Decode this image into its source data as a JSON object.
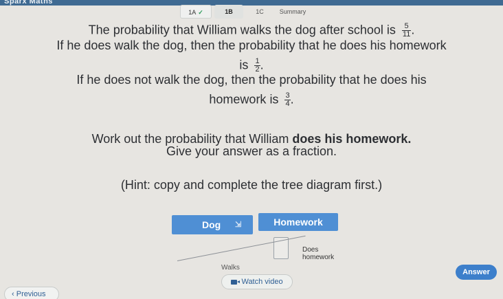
{
  "app": {
    "logo": "Sparx Maths"
  },
  "tabs": [
    {
      "label": "1A",
      "completed": true
    },
    {
      "label": "1B"
    },
    {
      "label": "1C"
    },
    {
      "label": "Summary"
    }
  ],
  "question": {
    "line1_pre": "The probability that William walks the dog after school is",
    "p_walk": {
      "num": "5",
      "den": "11"
    },
    "line2": "If he does walk the dog, then the probability that he does his homework",
    "line3_pre": "is",
    "p_hw_given_walk": {
      "num": "1",
      "den": "2"
    },
    "line4": "If he does not walk the dog, then the probability that he does his",
    "line5_pre": "homework is",
    "p_hw_given_not": {
      "num": "3",
      "den": "4"
    },
    "line6_pre": "Work out the probability that William",
    "line6_bold": "does his homework.",
    "line7": "Give your answer as a fraction.",
    "hint": "(Hint: copy and complete the tree diagram first.)"
  },
  "diagram": {
    "dog_label": "Dog",
    "homework_label": "Homework",
    "does_homework_label_1": "Does",
    "does_homework_label_2": "homework",
    "walks_label": "Walks"
  },
  "buttons": {
    "watch_video": "Watch video",
    "answer": "Answer",
    "previous": "Previous"
  },
  "colors": {
    "accent": "#4f8fd4",
    "answer": "#3d7fcb",
    "background": "#e7e5e1"
  }
}
